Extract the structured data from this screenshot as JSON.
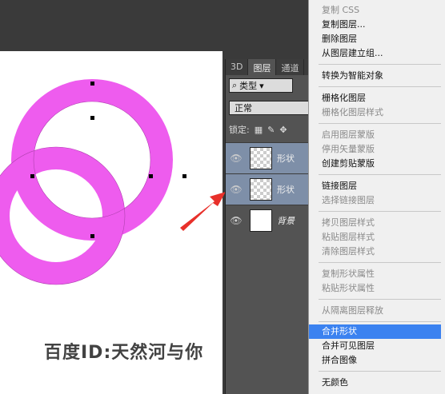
{
  "colors": {
    "ring": "#ee5cee",
    "menu_highlight": "#3b82f0",
    "arrow": "#e8302a"
  },
  "layers_panel": {
    "tabs": [
      "3D",
      "图层",
      "通道"
    ],
    "filter_label": "类型",
    "blend_mode": "正常",
    "lock_label": "锁定:",
    "layers": [
      {
        "name": "形状",
        "visible_icon": "eye-icon",
        "selected": true
      },
      {
        "name": "形状",
        "visible_icon": "eye-icon",
        "selected": true
      },
      {
        "name": "背景",
        "visible_icon": "eye-icon",
        "selected": false
      }
    ]
  },
  "context_menu": {
    "items": [
      {
        "label": "复制 CSS",
        "enabled": false
      },
      {
        "label": "复制图层...",
        "enabled": true
      },
      {
        "label": "删除图层",
        "enabled": true
      },
      {
        "label": "从图层建立组...",
        "enabled": true
      },
      {
        "label": "转换为智能对象",
        "enabled": true
      },
      {
        "label": "栅格化图层",
        "enabled": true
      },
      {
        "label": "栅格化图层样式",
        "enabled": false
      },
      {
        "label": "启用图层蒙版",
        "enabled": false
      },
      {
        "label": "停用矢量蒙版",
        "enabled": false
      },
      {
        "label": "创建剪贴蒙版",
        "enabled": true
      },
      {
        "label": "链接图层",
        "enabled": true
      },
      {
        "label": "选择链接图层",
        "enabled": false
      },
      {
        "label": "拷贝图层样式",
        "enabled": false
      },
      {
        "label": "粘贴图层样式",
        "enabled": false
      },
      {
        "label": "清除图层样式",
        "enabled": false
      },
      {
        "label": "复制形状属性",
        "enabled": false
      },
      {
        "label": "粘贴形状属性",
        "enabled": false
      },
      {
        "label": "从隔离图层释放",
        "enabled": false
      },
      {
        "label": "合并形状",
        "enabled": true,
        "highlighted": true
      },
      {
        "label": "合并可见图层",
        "enabled": true
      },
      {
        "label": "拼合图像",
        "enabled": true
      },
      {
        "label": "无颜色",
        "enabled": true
      }
    ]
  },
  "watermark": "百度ID:天然河与你"
}
